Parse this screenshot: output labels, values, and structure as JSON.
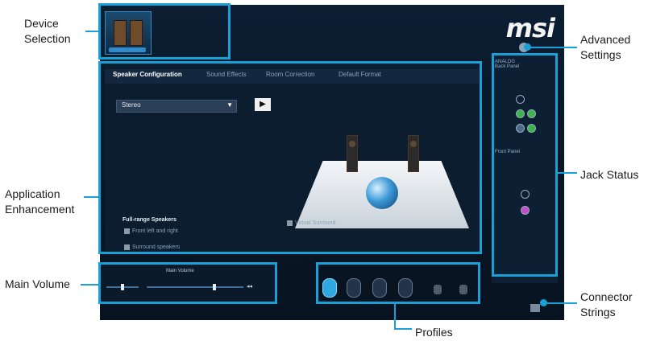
{
  "callouts": {
    "device_selection": [
      "Device",
      "Selection"
    ],
    "application_enhancement": [
      "Application",
      "Enhancement"
    ],
    "main_volume": "Main Volume",
    "advanced_settings": [
      "Advanced",
      "Settings"
    ],
    "jack_status": "Jack Status",
    "connector_strings": [
      "Connector",
      "Strings"
    ],
    "profiles": "Profiles"
  },
  "app": {
    "logo": "msi",
    "tabs": [
      "Speaker Configuration",
      "Sound Effects",
      "Room Correction",
      "Default Format"
    ],
    "speaker_select": {
      "value": "Stereo"
    },
    "options": {
      "heading": "Full-range Speakers",
      "front": "Front left and right",
      "surround": "Surround speakers",
      "virtual": "Virtual Surround"
    },
    "volume_label": "Main Volume",
    "jack": {
      "rear": "ANALOG\nBack Panel",
      "front": "Front Panel"
    }
  },
  "colors": {
    "accent": "#1a9fd6"
  }
}
